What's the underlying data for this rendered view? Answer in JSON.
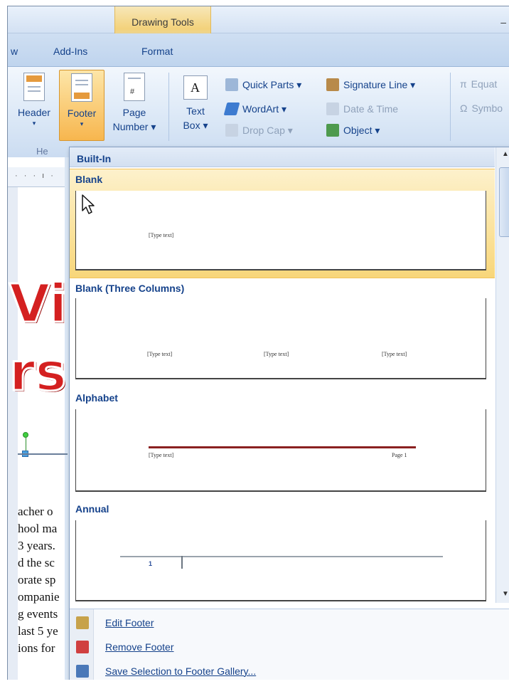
{
  "window": {
    "contextual_tab_group": "Drawing Tools",
    "window_control": "–"
  },
  "tabs": [
    {
      "label": "w"
    },
    {
      "label": "Add-Ins"
    },
    {
      "label": "Format"
    }
  ],
  "ribbon": {
    "header_label": "Header",
    "footer_label": "Footer",
    "footer_arrow": "▾",
    "page_number_label": [
      "Page",
      "Number ▾"
    ],
    "text_box_label": [
      "Text",
      "Box ▾"
    ],
    "quick_parts": "Quick Parts ▾",
    "wordart": "WordArt ▾",
    "drop_cap": "Drop Cap ▾",
    "signature_line": "Signature Line ▾",
    "date_time": "Date & Time",
    "object": "Object ▾",
    "equation": "Equat",
    "symbol": "Symbo",
    "group_label_partial": "He",
    "header_arrow": "▾"
  },
  "document": {
    "ruler": "· · · ı ·",
    "wordart_lines": [
      "Vi",
      "rs"
    ],
    "body_lines": [
      "acher o",
      "hool ma",
      "3 years.",
      "d the sc",
      "orate sp",
      "ompanie",
      "g events",
      "last 5 ye",
      "ions for"
    ]
  },
  "gallery": {
    "section_title": "Built-In",
    "items": [
      {
        "name": "Blank",
        "placeholders": [
          "[Type text]"
        ]
      },
      {
        "name": "Blank (Three Columns)",
        "placeholders": [
          "[Type text]",
          "[Type text]",
          "[Type text]"
        ]
      },
      {
        "name": "Alphabet",
        "placeholders": [
          "[Type text]",
          "Page 1"
        ]
      },
      {
        "name": "Annual",
        "placeholders": [
          "1"
        ]
      }
    ],
    "scroll_up": "▲",
    "scroll_down": "▼"
  },
  "menu": {
    "items": [
      {
        "label": "Edit Footer",
        "icon": "edit-footer-icon",
        "color": "#c7a24a"
      },
      {
        "label": "Remove Footer",
        "icon": "remove-footer-icon",
        "color": "#d04040"
      },
      {
        "label": "Save Selection to Footer Gallery...",
        "icon": "save-to-gallery-icon",
        "color": "#4a78b8"
      }
    ]
  },
  "colors": {
    "accent_selected": "#f8d67a",
    "ribbon_text": "#15428b",
    "wordart_red": "#d42020"
  }
}
